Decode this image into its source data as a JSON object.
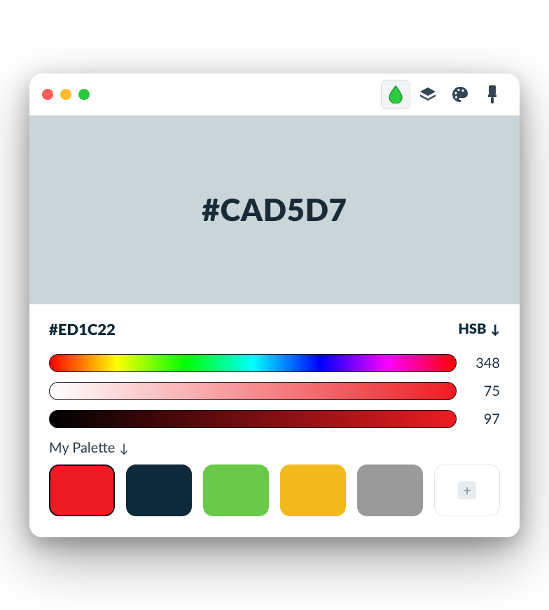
{
  "preview": {
    "hex": "#CAD5D7",
    "bg": "#CAD5D7"
  },
  "selected": {
    "hex": "#ED1C22"
  },
  "mode": {
    "label": "HSB",
    "arrow": "↓"
  },
  "sliders": {
    "hue": 348,
    "sat": 75,
    "bri": 97
  },
  "slider_colors": {
    "sat_start": "#ffffff",
    "sat_end": "#ED1C22",
    "bri_start": "#000000",
    "bri_end": "#ED1C22"
  },
  "palette": {
    "label": "My Palette",
    "arrow": "↓",
    "items": [
      {
        "color": "#ED1C22",
        "selected": true
      },
      {
        "color": "#0E2A3A",
        "selected": false
      },
      {
        "color": "#6BC94A",
        "selected": false
      },
      {
        "color": "#F3BA1D",
        "selected": false
      },
      {
        "color": "#9A9A9A",
        "selected": false
      }
    ],
    "add_glyph": "+"
  },
  "toolbar": {
    "icons": [
      {
        "name": "drop-icon",
        "active": true
      },
      {
        "name": "layers-icon",
        "active": false
      },
      {
        "name": "palette-icon",
        "active": false
      },
      {
        "name": "brush-icon",
        "active": false
      }
    ]
  }
}
